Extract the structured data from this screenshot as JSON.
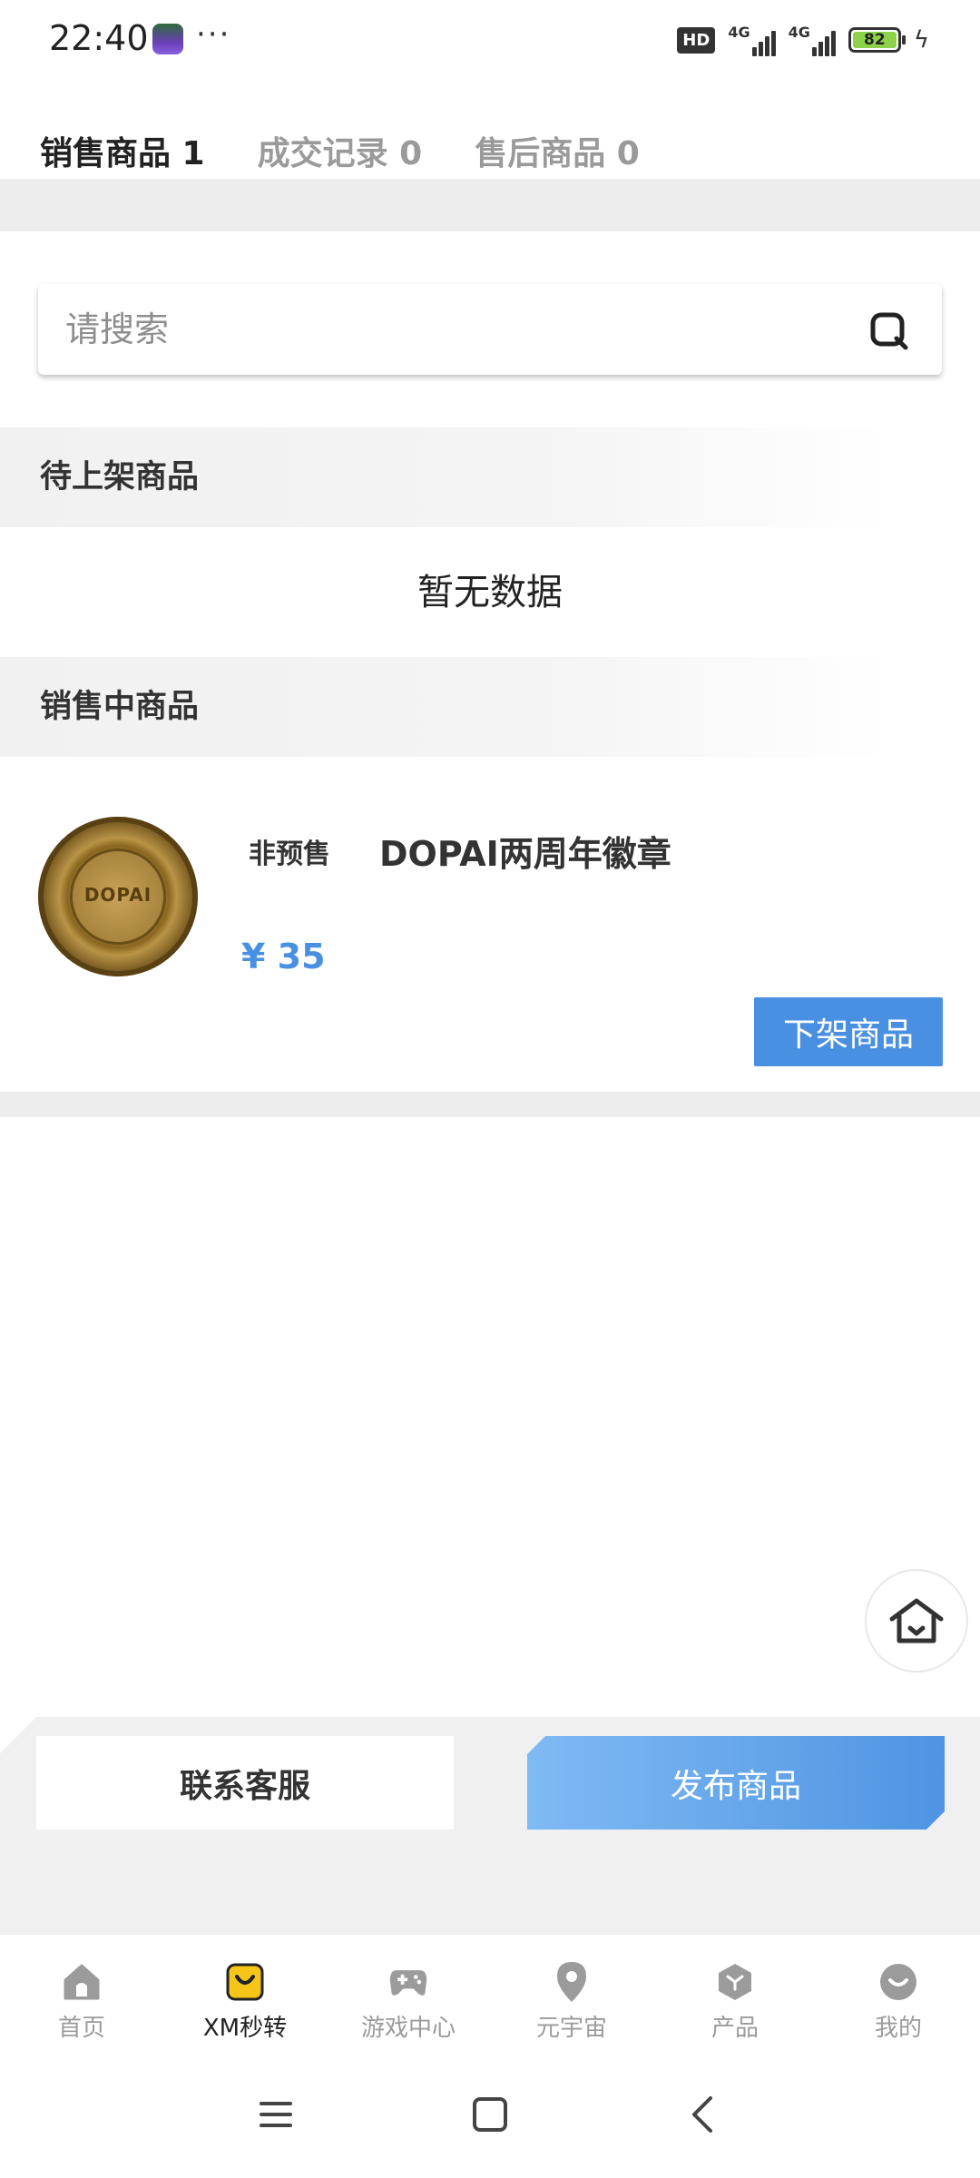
{
  "status_bar": {
    "time": "22:40",
    "more": "···",
    "hd": "HD",
    "network_1": "4G",
    "network_2": "4G",
    "battery": "82"
  },
  "tabs": [
    {
      "label": "销售商品 1",
      "active": true
    },
    {
      "label": "成交记录 0",
      "active": false
    },
    {
      "label": "售后商品 0",
      "active": false
    }
  ],
  "search": {
    "placeholder": "请搜索",
    "value": ""
  },
  "pending_section": {
    "title": "待上架商品",
    "empty_text": "暂无数据"
  },
  "selling_section": {
    "title": "销售中商品",
    "items": [
      {
        "image_text": "DOPAI",
        "tag": "非预售",
        "name": "DOPAI两周年徽章",
        "price": "¥ 35",
        "action_label": "下架商品"
      }
    ]
  },
  "actions": {
    "contact_label": "联系客服",
    "publish_label": "发布商品"
  },
  "bottom_nav": [
    {
      "label": "首页",
      "icon": "home-icon",
      "active": false
    },
    {
      "label": "XM秒转",
      "icon": "shopping-bag-icon",
      "active": true
    },
    {
      "label": "游戏中心",
      "icon": "gamepad-icon",
      "active": false
    },
    {
      "label": "元宇宙",
      "icon": "location-pin-icon",
      "active": false
    },
    {
      "label": "产品",
      "icon": "cube-icon",
      "active": false
    },
    {
      "label": "我的",
      "icon": "profile-icon",
      "active": false
    }
  ],
  "colors": {
    "accent": "#4a90e2",
    "active_nav": "#f5c518",
    "inactive": "#9b9b9b"
  }
}
